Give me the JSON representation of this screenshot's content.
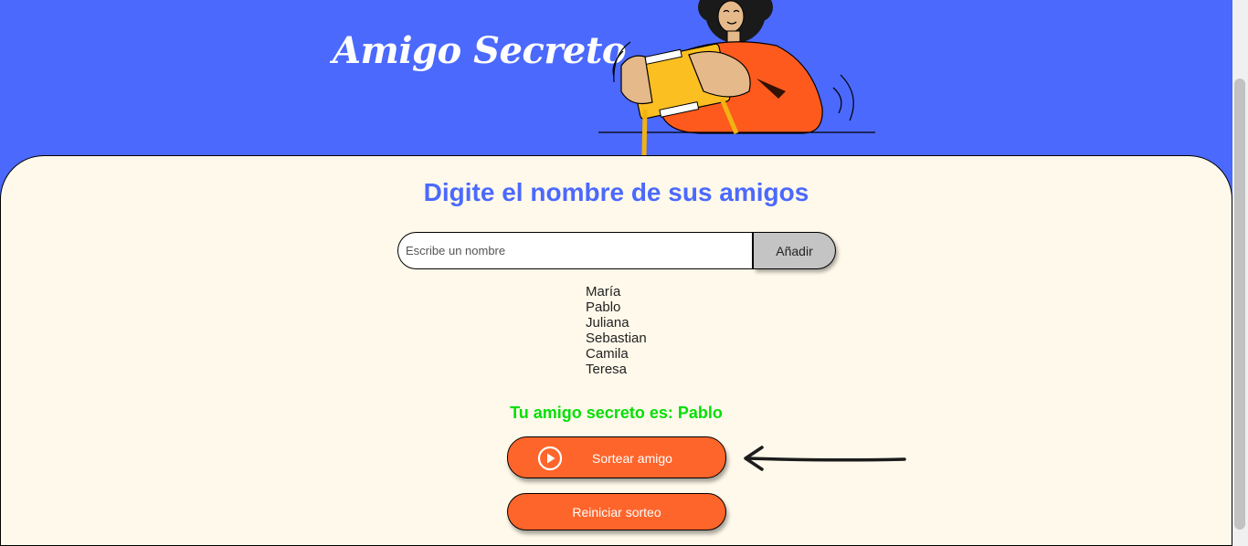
{
  "header": {
    "title": "Amigo Secreto"
  },
  "main": {
    "subtitle": "Digite el nombre de sus amigos",
    "input": {
      "placeholder": "Escribe un nombre",
      "value": ""
    },
    "add_button": "Añadir",
    "friends": [
      "María",
      "Pablo",
      "Juliana",
      "Sebastian",
      "Camila",
      "Teresa"
    ],
    "result": "Tu amigo secreto es: Pablo",
    "draw_button": {
      "label": "Sortear amigo",
      "icon": "play-circle-icon"
    },
    "reset_button": "Reiniciar sorteo"
  },
  "colors": {
    "header_bg": "#4b69fd",
    "main_bg": "#fff9eb",
    "accent_blue": "#4b69fd",
    "button_orange": "#fe652b",
    "result_green": "#05df05",
    "add_button_bg": "#c4c4c4"
  }
}
